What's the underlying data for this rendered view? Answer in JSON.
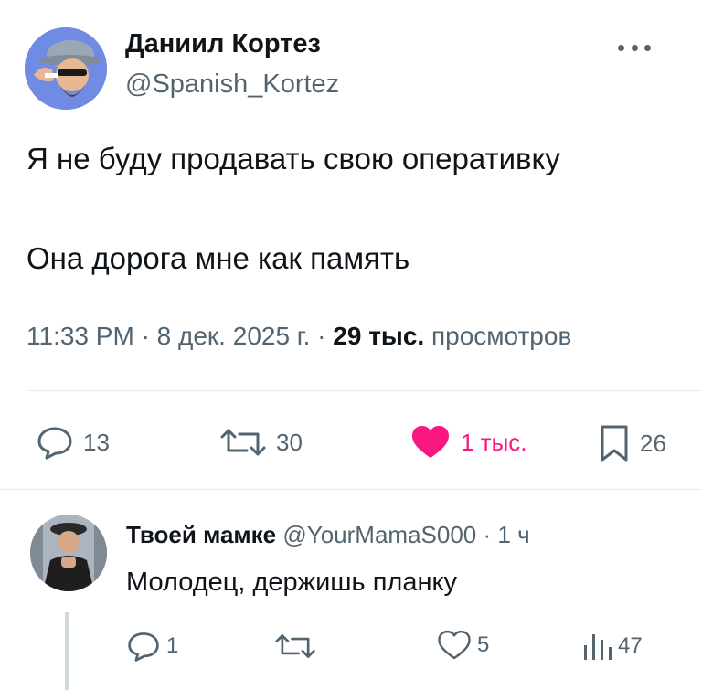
{
  "tweet": {
    "author_name": "Даниил Кортез",
    "author_handle": "@Spanish_Kortez",
    "text_line1": "Я не буду продавать свою оперативку",
    "text_line2": "Она дорога мне как память",
    "time": "11:33 PM",
    "separator": "·",
    "date": "8 дек. 2025 г.",
    "views_count": "29 тыс.",
    "views_label": "просмотров",
    "actions": {
      "replies": "13",
      "reposts": "30",
      "likes": "1 тыс.",
      "bookmarks": "26"
    }
  },
  "reply": {
    "name": "Твоей мамке",
    "handle": "@YourMamaS000",
    "separator": "·",
    "time": "1 ч",
    "text": "Молодец, держишь планку",
    "actions": {
      "replies": "1",
      "likes": "5",
      "views": "47"
    }
  },
  "colors": {
    "text_primary": "#0f1419",
    "text_secondary": "#536471",
    "like_active": "#f91880",
    "divider": "#e6ecf0"
  },
  "icons": {
    "more": "more-horizontal-icon",
    "reply": "reply-bubble-icon",
    "repost": "repost-arrows-icon",
    "like": "heart-icon",
    "bookmark": "bookmark-icon",
    "views": "views-bars-icon"
  }
}
